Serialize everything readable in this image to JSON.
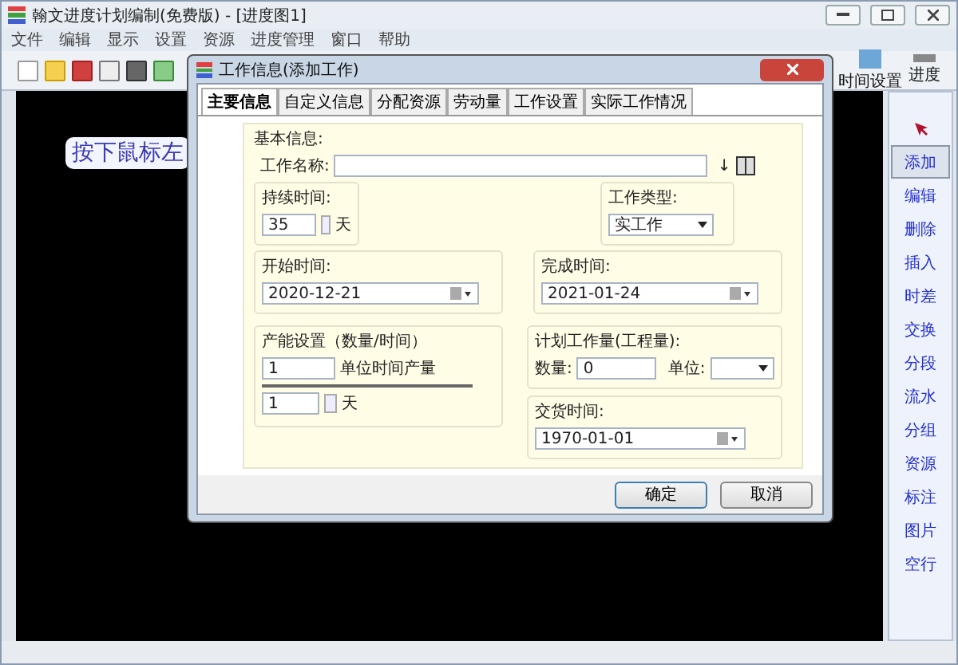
{
  "window": {
    "title": "翰文进度计划编制(免费版) - [进度图1]"
  },
  "menu": [
    "文件",
    "编辑",
    "显示",
    "设置",
    "资源",
    "进度管理",
    "窗口",
    "帮助"
  ],
  "toolbar": {
    "right_buttons": [
      {
        "label": "时间设置",
        "kind": "calendar"
      },
      {
        "label": "进度",
        "kind": "progress"
      }
    ]
  },
  "canvas": {
    "hint": "按下鼠标左"
  },
  "tool_panel": [
    {
      "kind": "pointer",
      "selected": false
    },
    {
      "kind": "text",
      "label": "添加",
      "selected": true
    },
    {
      "kind": "text",
      "label": "编辑",
      "selected": false
    },
    {
      "kind": "text",
      "label": "删除",
      "selected": false
    },
    {
      "kind": "text",
      "label": "插入",
      "selected": false
    },
    {
      "kind": "text",
      "label": "时差",
      "selected": false
    },
    {
      "kind": "text",
      "label": "交换",
      "selected": false
    },
    {
      "kind": "text",
      "label": "分段",
      "selected": false
    },
    {
      "kind": "text",
      "label": "流水",
      "selected": false
    },
    {
      "kind": "text",
      "label": "分组",
      "selected": false
    },
    {
      "kind": "text",
      "label": "资源",
      "selected": false
    },
    {
      "kind": "text",
      "label": "标注",
      "selected": false
    },
    {
      "kind": "text",
      "label": "图片",
      "selected": false
    },
    {
      "kind": "text",
      "label": "空行",
      "selected": false
    }
  ],
  "dialog": {
    "title": "工作信息(添加工作)",
    "tabs": [
      {
        "label": "主要信息",
        "selected": true
      },
      {
        "label": "自定义信息",
        "selected": false
      },
      {
        "label": "分配资源",
        "selected": false
      },
      {
        "label": "劳动量",
        "selected": false
      },
      {
        "label": "工作设置",
        "selected": false
      },
      {
        "label": "实际工作情况",
        "selected": false
      }
    ],
    "basic_info": {
      "title": "基本信息:",
      "name_label": "工作名称:",
      "arrow": "↓"
    },
    "duration": {
      "title": "持续时间:",
      "value": "35",
      "unit": "天"
    },
    "work_type": {
      "title": "工作类型:",
      "value": "实工作"
    },
    "start": {
      "title": "开始时间:",
      "value": "2020-12-21"
    },
    "finish": {
      "title": "完成时间:",
      "value": "2021-01-24"
    },
    "capacity": {
      "title": "产能设置（数量/时间）",
      "amount": "1",
      "amount_label": "单位时间产量",
      "period": "1",
      "period_unit": "天"
    },
    "planned_work": {
      "title": "计划工作量(工程量):",
      "quantity_label": "数量:",
      "quantity": "0",
      "unit_label": "单位:"
    },
    "delivery": {
      "title": "交货时间:",
      "value": "1970-01-01"
    },
    "buttons": [
      {
        "label": "确定",
        "kind": "primary"
      },
      {
        "label": "取消",
        "kind": "normal"
      }
    ]
  }
}
